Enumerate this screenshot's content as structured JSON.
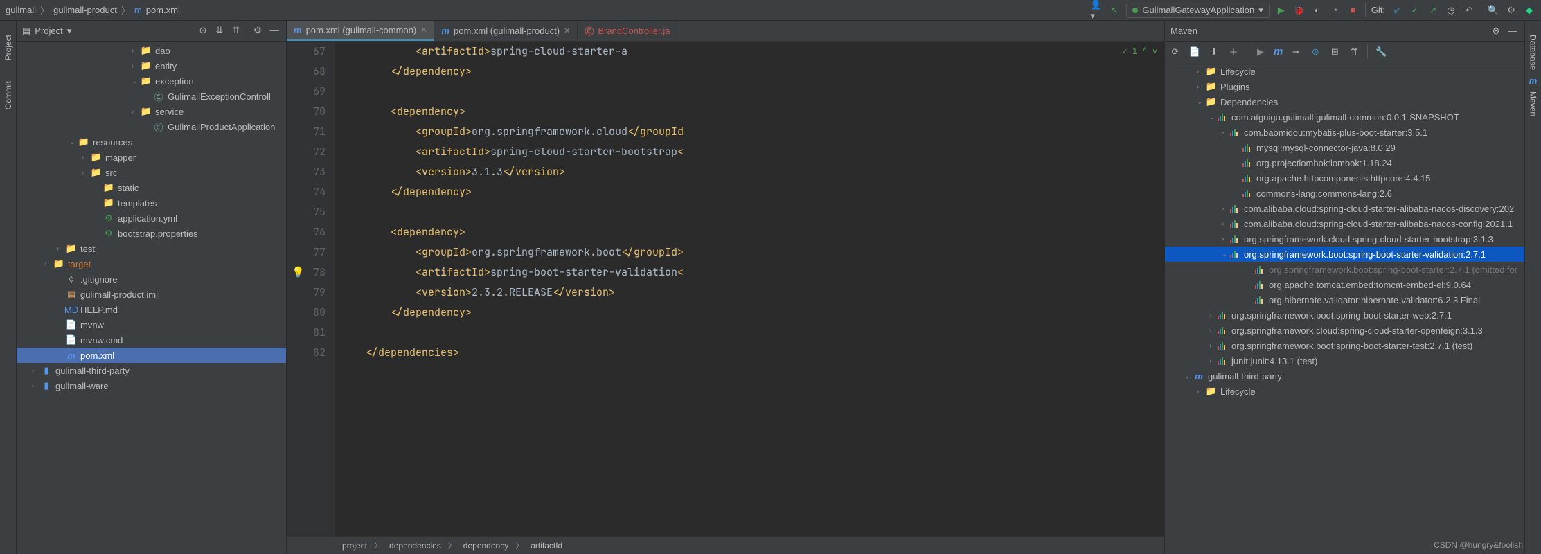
{
  "breadcrumb": {
    "root": "gulimall",
    "module": "gulimall-product",
    "file": "pom.xml"
  },
  "topbar": {
    "runConfig": "GulimallGatewayApplication",
    "gitLabel": "Git:"
  },
  "project": {
    "title": "Project",
    "items": [
      {
        "pad": 166,
        "arrow": "›",
        "icon": "folder",
        "label": "dao"
      },
      {
        "pad": 166,
        "arrow": "›",
        "icon": "folder",
        "label": "entity"
      },
      {
        "pad": 166,
        "arrow": "⌄",
        "icon": "folder",
        "label": "exception"
      },
      {
        "pad": 184,
        "arrow": "",
        "icon": "class",
        "label": "GulimallExceptionControll"
      },
      {
        "pad": 166,
        "arrow": "›",
        "icon": "folder",
        "label": "service"
      },
      {
        "pad": 184,
        "arrow": "",
        "icon": "class-sp",
        "label": "GulimallProductApplication"
      },
      {
        "pad": 76,
        "arrow": "⌄",
        "icon": "folder-res",
        "label": "resources"
      },
      {
        "pad": 94,
        "arrow": "›",
        "icon": "folder",
        "label": "mapper"
      },
      {
        "pad": 94,
        "arrow": "›",
        "icon": "folder",
        "label": "src"
      },
      {
        "pad": 112,
        "arrow": "",
        "icon": "folder",
        "label": "static"
      },
      {
        "pad": 112,
        "arrow": "",
        "icon": "folder",
        "label": "templates"
      },
      {
        "pad": 112,
        "arrow": "",
        "icon": "yml",
        "label": "application.yml",
        "cls": "green"
      },
      {
        "pad": 112,
        "arrow": "",
        "icon": "props",
        "label": "bootstrap.properties",
        "cls": "green"
      },
      {
        "pad": 58,
        "arrow": "›",
        "icon": "folder-test",
        "label": "test"
      },
      {
        "pad": 40,
        "arrow": "›",
        "icon": "folder-orange",
        "label": "target",
        "cls": "orange"
      },
      {
        "pad": 58,
        "arrow": "",
        "icon": "git",
        "label": ".gitignore"
      },
      {
        "pad": 58,
        "arrow": "",
        "icon": "iml",
        "label": "gulimall-product.iml"
      },
      {
        "pad": 58,
        "arrow": "",
        "icon": "md",
        "label": "HELP.md"
      },
      {
        "pad": 58,
        "arrow": "",
        "icon": "file",
        "label": "mvnw"
      },
      {
        "pad": 58,
        "arrow": "",
        "icon": "file",
        "label": "mvnw.cmd"
      },
      {
        "pad": 58,
        "arrow": "",
        "icon": "m",
        "label": "pom.xml",
        "selected": true
      },
      {
        "pad": 22,
        "arrow": "›",
        "icon": "module",
        "label": "gulimall-third-party"
      },
      {
        "pad": 22,
        "arrow": "›",
        "icon": "module",
        "label": "gulimall-ware"
      }
    ]
  },
  "tabs": [
    {
      "icon": "m",
      "label": "pom.xml (gulimall-common)",
      "active": true,
      "close": true
    },
    {
      "icon": "m",
      "label": "pom.xml (gulimall-product)",
      "active": false,
      "close": true
    },
    {
      "icon": "c",
      "label": "BrandController.ja",
      "active": false,
      "close": false,
      "red": true
    }
  ],
  "editor": {
    "lines": [
      {
        "n": 67,
        "html": "            <span class='tag'>&lt;artifactId&gt;</span><span class='text'>spring-cloud-starter-a</span>"
      },
      {
        "n": 68,
        "html": "        <span class='tag'>&lt;/dependency&gt;</span>"
      },
      {
        "n": 69,
        "html": ""
      },
      {
        "n": 70,
        "html": "        <span class='tag'>&lt;dependency&gt;</span>"
      },
      {
        "n": 71,
        "html": "            <span class='tag'>&lt;groupId&gt;</span><span class='text'>org.springframework.cloud</span><span class='tag'>&lt;/groupId</span>"
      },
      {
        "n": 72,
        "html": "            <span class='tag'>&lt;artifactId&gt;</span><span class='text'>spring-cloud-starter-bootstrap</span><span class='tag'>&lt;</span>"
      },
      {
        "n": 73,
        "html": "            <span class='tag'>&lt;version&gt;</span><span class='text'>3.1.3</span><span class='tag'>&lt;/version&gt;</span>"
      },
      {
        "n": 74,
        "html": "        <span class='tag'>&lt;/dependency&gt;</span>"
      },
      {
        "n": 75,
        "html": ""
      },
      {
        "n": 76,
        "html": "        <span class='tag'>&lt;dependency&gt;</span>"
      },
      {
        "n": 77,
        "html": "            <span class='tag'>&lt;groupId&gt;</span><span class='text'>org.springframework.boot</span><span class='tag'>&lt;/groupId&gt;</span>"
      },
      {
        "n": 78,
        "html": "            <span class='tag'>&lt;artifactId&gt;</span><span class='text'>spring-boot-starter-validation</span><span class='tag'>&lt;</span>",
        "bulb": true
      },
      {
        "n": 79,
        "html": "            <span class='tag'>&lt;version&gt;</span><span class='text'>2.3.2.RELEASE</span><span class='tag'>&lt;/version&gt;</span>"
      },
      {
        "n": 80,
        "html": "        <span class='tag'>&lt;/dependency&gt;</span>"
      },
      {
        "n": 81,
        "html": ""
      },
      {
        "n": 82,
        "html": "    <span class='tag'>&lt;/dependencies&gt;</span>"
      }
    ],
    "status": "✓ 1 ^ ∨",
    "breadcrumb": [
      "project",
      "dependencies",
      "dependency",
      "artifactId"
    ]
  },
  "maven": {
    "title": "Maven",
    "items": [
      {
        "pad": 26,
        "arrow": "›",
        "icon": "folder",
        "label": "Lifecycle"
      },
      {
        "pad": 26,
        "arrow": "›",
        "icon": "folder",
        "label": "Plugins"
      },
      {
        "pad": 26,
        "arrow": "⌄",
        "icon": "folder",
        "label": "Dependencies"
      },
      {
        "pad": 44,
        "arrow": "⌄",
        "icon": "bars",
        "label": "com.atguigu.gulimall:gulimall-common:0.0.1-SNAPSHOT"
      },
      {
        "pad": 62,
        "arrow": "›",
        "icon": "bars",
        "label": "com.baomidou:mybatis-plus-boot-starter:3.5.1"
      },
      {
        "pad": 80,
        "arrow": "",
        "icon": "bars",
        "label": "mysql:mysql-connector-java:8.0.29"
      },
      {
        "pad": 80,
        "arrow": "",
        "icon": "bars",
        "label": "org.projectlombok:lombok:1.18.24"
      },
      {
        "pad": 80,
        "arrow": "",
        "icon": "bars",
        "label": "org.apache.httpcomponents:httpcore:4.4.15"
      },
      {
        "pad": 80,
        "arrow": "",
        "icon": "bars",
        "label": "commons-lang:commons-lang:2.6"
      },
      {
        "pad": 62,
        "arrow": "›",
        "icon": "bars",
        "label": "com.alibaba.cloud:spring-cloud-starter-alibaba-nacos-discovery:202"
      },
      {
        "pad": 62,
        "arrow": "›",
        "icon": "bars",
        "label": "com.alibaba.cloud:spring-cloud-starter-alibaba-nacos-config:2021.1"
      },
      {
        "pad": 62,
        "arrow": "›",
        "icon": "bars",
        "label": "org.springframework.cloud:spring-cloud-starter-bootstrap:3.1.3"
      },
      {
        "pad": 62,
        "arrow": "⌄",
        "icon": "bars",
        "label": "org.springframework.boot:spring-boot-starter-validation:2.7.1",
        "selected": true
      },
      {
        "pad": 98,
        "arrow": "",
        "icon": "bars",
        "label": "org.springframework.boot:spring-boot-starter:2.7.1 (omitted for",
        "dim": true
      },
      {
        "pad": 98,
        "arrow": "",
        "icon": "bars",
        "label": "org.apache.tomcat.embed:tomcat-embed-el:9.0.64"
      },
      {
        "pad": 98,
        "arrow": "",
        "icon": "bars",
        "label": "org.hibernate.validator:hibernate-validator:6.2.3.Final"
      },
      {
        "pad": 44,
        "arrow": "›",
        "icon": "bars",
        "label": "org.springframework.boot:spring-boot-starter-web:2.7.1"
      },
      {
        "pad": 44,
        "arrow": "›",
        "icon": "bars",
        "label": "org.springframework.cloud:spring-cloud-starter-openfeign:3.1.3"
      },
      {
        "pad": 44,
        "arrow": "›",
        "icon": "bars",
        "label": "org.springframework.boot:spring-boot-starter-test:2.7.1 (test)"
      },
      {
        "pad": 44,
        "arrow": "›",
        "icon": "bars",
        "label": "junit:junit:4.13.1 (test)"
      },
      {
        "pad": 8,
        "arrow": "⌄",
        "icon": "m",
        "label": "gulimall-third-party"
      },
      {
        "pad": 26,
        "arrow": "›",
        "icon": "folder",
        "label": "Lifecycle"
      }
    ]
  },
  "rails": {
    "project": "Project",
    "commit": "Commit",
    "database": "Database",
    "maven": "Maven"
  },
  "watermark": "CSDN @hungry&foolish"
}
